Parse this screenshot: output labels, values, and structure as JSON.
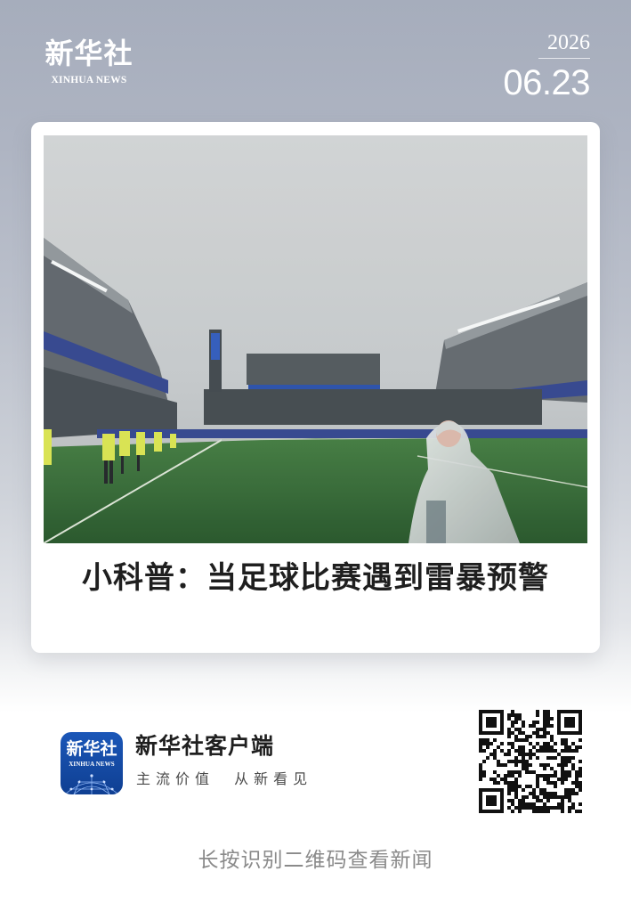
{
  "header": {
    "brand_cn": "新华社",
    "brand_en": "XINHUA NEWS",
    "year": "2026",
    "month_day": "06.23"
  },
  "card": {
    "image_icon": "stadium-rain-photo",
    "headline": "小科普：当足球比赛遇到雷暴预警"
  },
  "footer": {
    "app_logo_cn": "新华社",
    "app_logo_en": "XINHUA NEWS",
    "app_name": "新华社客户端",
    "slogan": "主流价值  从新看见",
    "qr_icon": "qr-code-icon",
    "hint": "长按识别二维码查看新闻"
  }
}
